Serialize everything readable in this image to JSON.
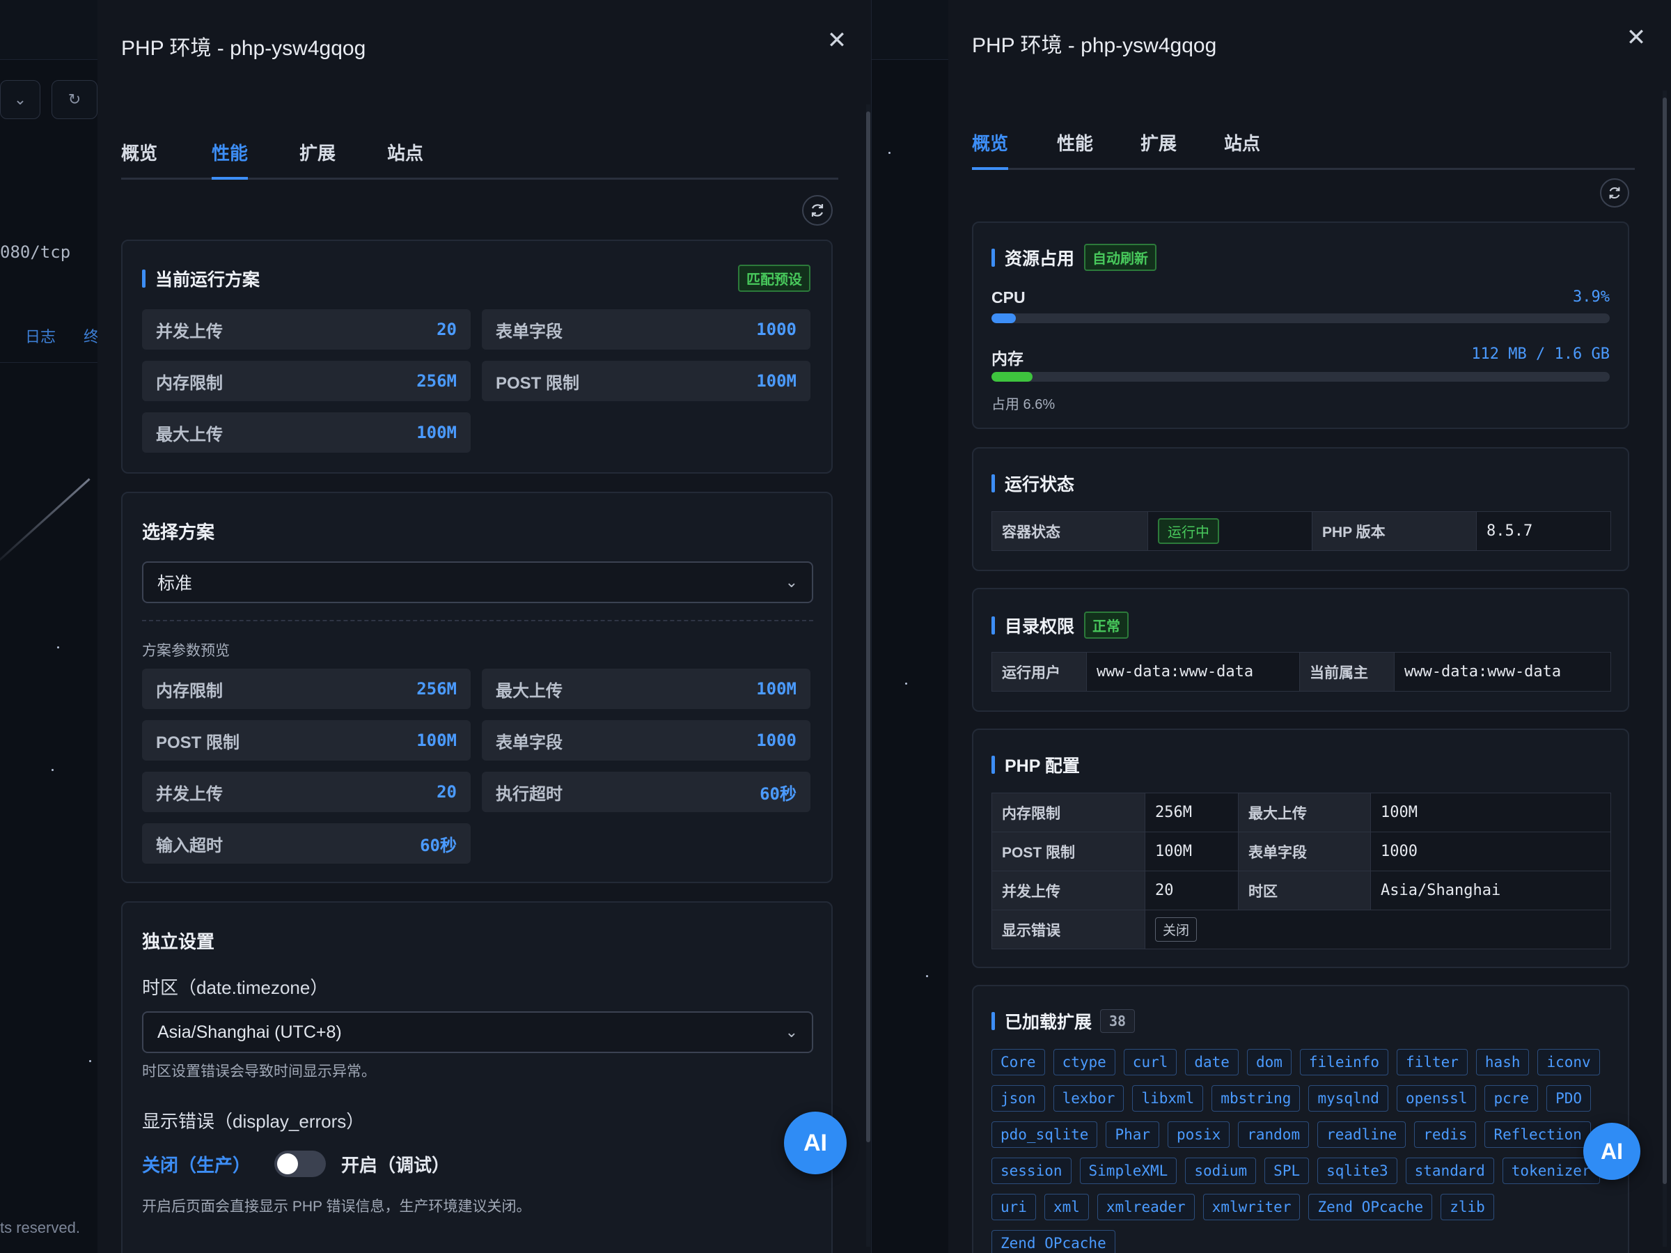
{
  "background": {
    "port_text": "080/tcp",
    "links": [
      "日志",
      "终"
    ],
    "rights": "ts reserved."
  },
  "left": {
    "title": "PHP 环境 - php-ysw4gqog",
    "tabs": [
      "概览",
      "性能",
      "扩展",
      "站点"
    ],
    "active_tab": 1,
    "current": {
      "title": "当前运行方案",
      "badge": "匹配预设",
      "items": [
        {
          "k": "并发上传",
          "v": "20"
        },
        {
          "k": "表单字段",
          "v": "1000"
        },
        {
          "k": "内存限制",
          "v": "256M"
        },
        {
          "k": "POST 限制",
          "v": "100M"
        },
        {
          "k": "最大上传",
          "v": "100M"
        }
      ]
    },
    "choose": {
      "title": "选择方案",
      "selected": "标准",
      "preview_label": "方案参数预览",
      "items": [
        {
          "k": "内存限制",
          "v": "256M"
        },
        {
          "k": "最大上传",
          "v": "100M"
        },
        {
          "k": "POST 限制",
          "v": "100M"
        },
        {
          "k": "表单字段",
          "v": "1000"
        },
        {
          "k": "并发上传",
          "v": "20"
        },
        {
          "k": "执行超时",
          "v": "60秒"
        },
        {
          "k": "输入超时",
          "v": "60秒"
        }
      ]
    },
    "independent": {
      "title": "独立设置",
      "tz_label": "时区（date.timezone）",
      "tz_value": "Asia/Shanghai (UTC+8)",
      "tz_hint": "时区设置错误会导致时间显示异常。",
      "err_label": "显示错误（display_errors）",
      "off_label": "关闭（生产）",
      "on_label": "开启（调试）",
      "err_hint": "开启后页面会直接显示 PHP 错误信息，生产环境建议关闭。"
    },
    "ai_label": "AI"
  },
  "right": {
    "title": "PHP 环境 - php-ysw4gqog",
    "tabs": [
      "概览",
      "性能",
      "扩展",
      "站点"
    ],
    "active_tab": 0,
    "resources": {
      "title": "资源占用",
      "badge": "自动刷新",
      "cpu_label": "CPU",
      "cpu_value": "3.9%",
      "cpu_fraction": 0.039,
      "mem_label": "内存",
      "mem_value": "112 MB / 1.6 GB",
      "mem_fraction": 0.066,
      "mem_usage": "占用 6.6%"
    },
    "run_status": {
      "title": "运行状态",
      "container_label": "容器状态",
      "container_value": "运行中",
      "php_label": "PHP 版本",
      "php_value": "8.5.7"
    },
    "dir_perm": {
      "title": "目录权限",
      "badge": "正常",
      "user_label": "运行用户",
      "user_value": "www-data:www-data",
      "owner_label": "当前属主",
      "owner_value": "www-data:www-data"
    },
    "php_config": {
      "title": "PHP 配置",
      "rows": [
        [
          "内存限制",
          "256M",
          "最大上传",
          "100M"
        ],
        [
          "POST 限制",
          "100M",
          "表单字段",
          "1000"
        ],
        [
          "并发上传",
          "20",
          "时区",
          "Asia/Shanghai"
        ]
      ],
      "err_label": "显示错误",
      "err_value": "关闭"
    },
    "extensions": {
      "title": "已加载扩展",
      "count": "38",
      "items": [
        "Core",
        "ctype",
        "curl",
        "date",
        "dom",
        "fileinfo",
        "filter",
        "hash",
        "iconv",
        "json",
        "lexbor",
        "libxml",
        "mbstring",
        "mysqlnd",
        "openssl",
        "pcre",
        "PDO",
        "pdo_sqlite",
        "Phar",
        "posix",
        "random",
        "readline",
        "redis",
        "Reflection",
        "session",
        "SimpleXML",
        "sodium",
        "SPL",
        "sqlite3",
        "standard",
        "tokenizer",
        "uri",
        "xml",
        "xmlreader",
        "xmlwriter",
        "Zend OPcache",
        "zlib",
        "Zend OPcache"
      ]
    },
    "ai_label": "AI"
  },
  "colors": {
    "accent": "#3d8ef6",
    "value_blue": "#4b9bff",
    "success": "#48c95c"
  }
}
